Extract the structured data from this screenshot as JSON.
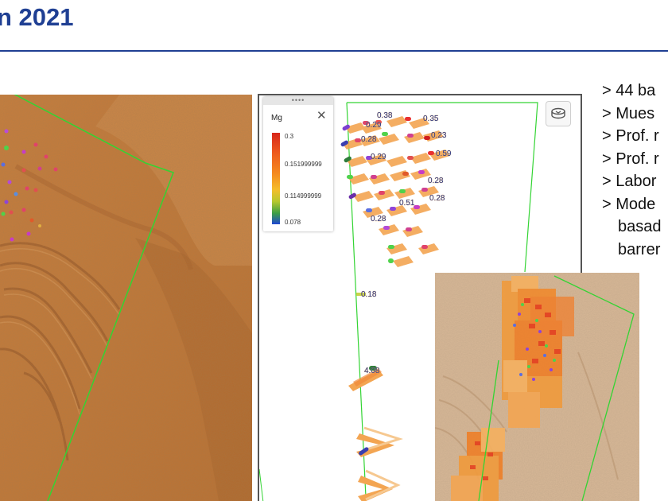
{
  "slide": {
    "title": "n 2021"
  },
  "viewer": {
    "legend": {
      "variable": "Mg",
      "close_icon": "close-icon",
      "grip": "••••",
      "values": [
        "0.3",
        "0.151999999",
        "0.114999999",
        "0.078"
      ]
    },
    "view_button_icon": "cube-view-icon",
    "sample_labels": [
      "0.38",
      "0.29",
      "0.35",
      "0.23",
      "0.28",
      "0.59",
      "0.29",
      "0.28",
      "0.28",
      "0.51",
      "0.28",
      "0.18",
      "4.08"
    ]
  },
  "bullets": [
    "> 44 ba",
    "> Mues",
    "> Prof. r",
    "> Prof. r",
    "> Labor",
    "> Mode",
    "basad",
    "barrer"
  ],
  "colors": {
    "title": "#1f3f93",
    "terrain": "#c57a3a",
    "boundary": "#33d433"
  }
}
